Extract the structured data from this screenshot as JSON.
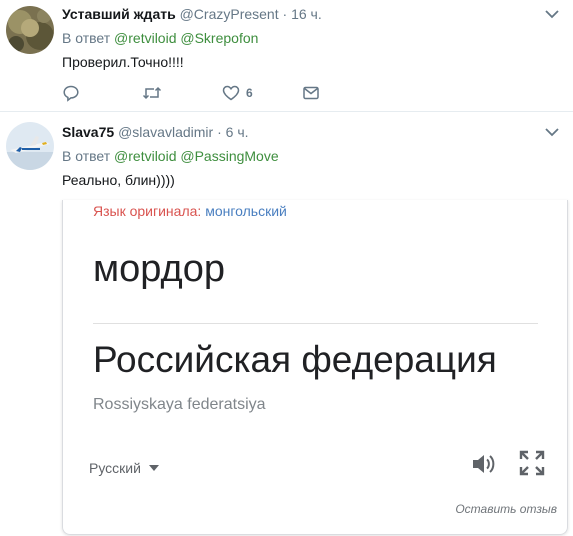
{
  "tweets": [
    {
      "name": "Уставший ждать",
      "handle": "@CrazyPresent",
      "separator": "·",
      "time": "16 ч.",
      "reply_prefix": "В ответ",
      "mentions": [
        "@retviloid",
        "@Skrepofon"
      ],
      "text": "Проверил.Точно!!!!",
      "like_count": "6"
    },
    {
      "name": "Slava75",
      "handle": "@slavavladimir",
      "separator": "·",
      "time": "6 ч.",
      "reply_prefix": "В ответ",
      "mentions": [
        "@retviloid",
        "@PassingMove"
      ],
      "text": "Реально, блин))))"
    }
  ],
  "translate_card": {
    "detected_label": "Язык оригинала:",
    "detected_language": "монгольский",
    "source_text": "мордор",
    "translation": "Российская федерация",
    "transliteration": "Rossiyskaya federatsiya",
    "target_language": "Русский",
    "feedback_link": "Оставить отзыв"
  },
  "colors": {
    "mention": "#3e8e3e",
    "meta_gray": "#657786",
    "detected_label": "#d9534f",
    "detected_language": "#4a7fc0"
  },
  "icons": [
    "caret-down-icon",
    "reply-icon",
    "retweet-icon",
    "like-icon",
    "direct-message-icon",
    "speaker-icon",
    "fullscreen-icon"
  ]
}
